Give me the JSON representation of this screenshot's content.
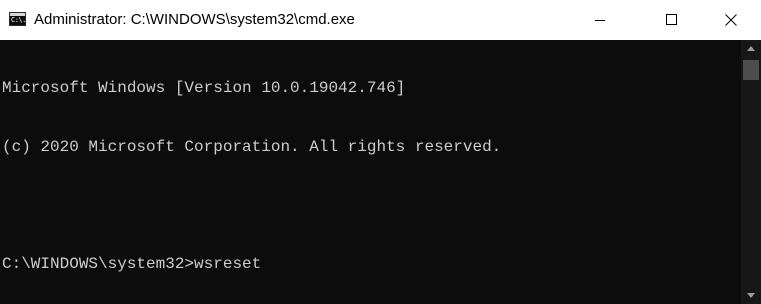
{
  "window": {
    "title": "Administrator: C:\\WINDOWS\\system32\\cmd.exe",
    "icon": "cmd-icon",
    "icon_text": "C:\\.",
    "buttons": {
      "minimize": "minimize-icon",
      "maximize": "maximize-icon",
      "close": "close-icon"
    }
  },
  "console": {
    "lines": [
      "Microsoft Windows [Version 10.0.19042.746]",
      "(c) 2020 Microsoft Corporation. All rights reserved.",
      "",
      "C:\\WINDOWS\\system32>wsreset"
    ],
    "colors": {
      "background": "#0c0c0c",
      "text": "#cccccc"
    }
  },
  "scrollbar": {
    "up_icon": "scroll-up-arrow-icon",
    "down_icon": "scroll-down-arrow-icon"
  }
}
